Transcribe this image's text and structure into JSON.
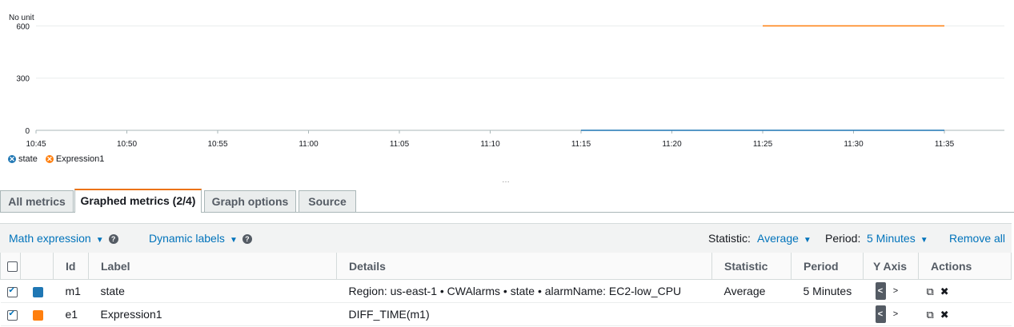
{
  "chart_data": {
    "type": "line",
    "ylabel": "No unit",
    "y_ticks": [
      "0",
      "300",
      "600"
    ],
    "x_ticks": [
      "10:45",
      "10:50",
      "10:55",
      "11:00",
      "11:05",
      "11:10",
      "11:15",
      "11:20",
      "11:25",
      "11:30",
      "11:35"
    ],
    "ylim": [
      0,
      680
    ],
    "series": [
      {
        "name": "state",
        "color": "#1f77b4",
        "points": [
          [
            "11:15",
            0
          ],
          [
            "11:35",
            0
          ]
        ]
      },
      {
        "name": "Expression1",
        "color": "#ff7f0e",
        "points": [
          [
            "11:25",
            600
          ],
          [
            "11:35",
            600
          ]
        ]
      }
    ],
    "grid": true,
    "legend": "bottom-left"
  },
  "legend": [
    {
      "label": "state",
      "color": "#1f77b4"
    },
    {
      "label": "Expression1",
      "color": "#ff7f0e"
    }
  ],
  "tabs": [
    "All metrics",
    "Graphed metrics (2/4)",
    "Graph options",
    "Source"
  ],
  "toolbar": {
    "math_expression": "Math expression",
    "dynamic_labels": "Dynamic labels",
    "statistic_label": "Statistic:",
    "statistic_value": "Average",
    "period_label": "Period:",
    "period_value": "5 Minutes",
    "remove_all": "Remove all"
  },
  "table": {
    "headers": {
      "id": "Id",
      "label": "Label",
      "details": "Details",
      "statistic": "Statistic",
      "period": "Period",
      "yaxis": "Y Axis",
      "actions": "Actions"
    },
    "rows": [
      {
        "id": "m1",
        "label": "state",
        "details": "Region: us-east-1 • CWAlarms • state • alarmName: EC2-low_CPU",
        "statistic": "Average",
        "period": "5 Minutes",
        "color": "#1f77b4"
      },
      {
        "id": "e1",
        "label": "Expression1",
        "details": "DIFF_TIME(m1)",
        "statistic": "",
        "period": "",
        "color": "#ff7f0e"
      }
    ]
  }
}
